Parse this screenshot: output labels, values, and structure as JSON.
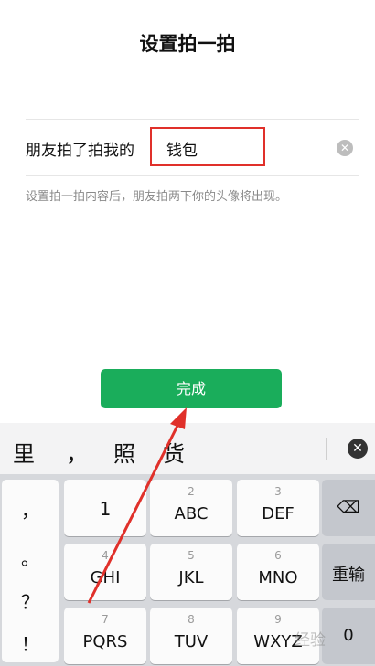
{
  "page": {
    "title": "设置拍一拍"
  },
  "form": {
    "prefix": "朋友拍了拍我的",
    "value": "钱包",
    "clear_icon": "✕",
    "hint": "设置拍一拍内容后，朋友拍两下你的头像将出现。"
  },
  "done_button": {
    "label": "完成"
  },
  "candidates": {
    "items": [
      "里",
      "，",
      "照",
      "货"
    ],
    "delete_icon": "✕"
  },
  "keyboard": {
    "symbols": [
      "，",
      "。",
      "？",
      "！"
    ],
    "keys": [
      {
        "num": "",
        "letters": "1"
      },
      {
        "num": "2",
        "letters": "ABC"
      },
      {
        "num": "3",
        "letters": "DEF"
      },
      {
        "num": "4",
        "letters": "GHI"
      },
      {
        "num": "5",
        "letters": "JKL"
      },
      {
        "num": "6",
        "letters": "MNO"
      },
      {
        "num": "7",
        "letters": "PQRS"
      },
      {
        "num": "8",
        "letters": "TUV"
      },
      {
        "num": "9",
        "letters": "WXYZ"
      }
    ],
    "backspace_icon": "⌫",
    "reenter_label": "重输",
    "zero_label": "0"
  },
  "watermark": {
    "text": "经验"
  },
  "colors": {
    "accent_green": "#1aad5b",
    "highlight_red": "#e0302a"
  }
}
